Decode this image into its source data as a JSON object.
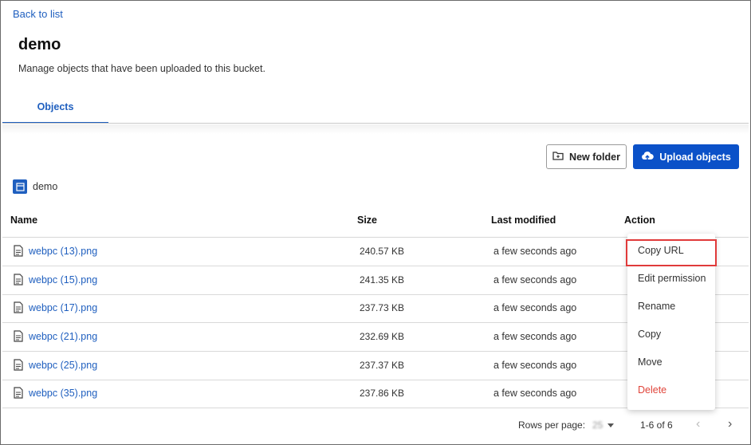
{
  "nav": {
    "back_label": "Back to list"
  },
  "page": {
    "title": "demo",
    "subtitle": "Manage objects that have been uploaded to this bucket."
  },
  "tabs": [
    {
      "label": "Objects",
      "active": true
    }
  ],
  "toolbar": {
    "new_folder_label": "New folder",
    "upload_label": "Upload objects"
  },
  "breadcrumb": {
    "label": "demo",
    "icon": "bucket-icon"
  },
  "table": {
    "headers": {
      "name": "Name",
      "size": "Size",
      "modified": "Last modified",
      "action": "Action"
    },
    "rows": [
      {
        "name": "webpc (13).png",
        "size": "240.57 KB",
        "modified": "a few seconds ago"
      },
      {
        "name": "webpc (15).png",
        "size": "241.35 KB",
        "modified": "a few seconds ago"
      },
      {
        "name": "webpc (17).png",
        "size": "237.73 KB",
        "modified": "a few seconds ago"
      },
      {
        "name": "webpc (21).png",
        "size": "232.69 KB",
        "modified": "a few seconds ago"
      },
      {
        "name": "webpc (25).png",
        "size": "237.37 KB",
        "modified": "a few seconds ago"
      },
      {
        "name": "webpc (35).png",
        "size": "237.86 KB",
        "modified": "a few seconds ago"
      }
    ]
  },
  "action_menu": {
    "items": [
      {
        "label": "Copy URL",
        "highlighted": true
      },
      {
        "label": "Edit permission"
      },
      {
        "label": "Rename"
      },
      {
        "label": "Copy"
      },
      {
        "label": "Move"
      },
      {
        "label": "Delete",
        "danger": true
      }
    ]
  },
  "pagination": {
    "rows_label": "Rows per page:",
    "rows_value": "25",
    "range": "1-6 of 6"
  },
  "colors": {
    "primary": "#0b51c8",
    "link": "#1f5fbf",
    "danger": "#e0453b",
    "highlight": "#e03a3a"
  }
}
